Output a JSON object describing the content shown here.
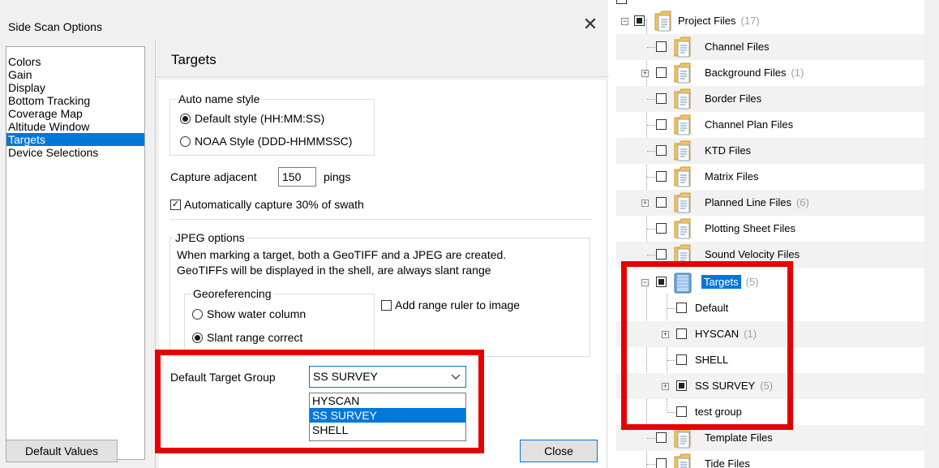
{
  "dialog": {
    "title": "Side Scan Options",
    "close_glyph": "✕",
    "nav_items": [
      "Colors",
      "Gain",
      "Display",
      "Bottom Tracking",
      "Coverage Map",
      "Altitude Window",
      "Targets",
      "Device Selections"
    ],
    "selected_nav": "Targets",
    "panel_heading": "Targets",
    "auto_name": {
      "label": "Auto name style",
      "options": [
        "Default style (HH:MM:SS)",
        "NOAA Style (DDD-HHMMSSC)"
      ],
      "selected": "Default style (HH:MM:SS)"
    },
    "capture": {
      "label": "Capture adjacent",
      "value": "150",
      "unit": "pings"
    },
    "auto_capture": {
      "label": "Automatically capture 30% of swath",
      "checked": true
    },
    "jpeg": {
      "label": "JPEG options",
      "desc_line1": "When marking a target, both a GeoTIFF and a JPEG are created.",
      "desc_line2": "GeoTIFFs will be displayed in the shell, are always slant range",
      "georef": {
        "label": "Georeferencing",
        "options": [
          "Show water column",
          "Slant range correct"
        ],
        "selected": "Slant range correct"
      },
      "range_ruler": {
        "label": "Add range ruler to image",
        "checked": false
      }
    },
    "target_group": {
      "label": "Default Target Group",
      "value": "SS SURVEY",
      "options": [
        "HYSCAN",
        "SS SURVEY",
        "SHELL"
      ],
      "highlighted": "SS SURVEY"
    },
    "buttons": {
      "default_values": "Default Values",
      "close": "Close"
    }
  },
  "tree": {
    "project_files": {
      "label": "Project Files",
      "count": "(17)"
    },
    "items": [
      {
        "label": "Channel Files",
        "count": ""
      },
      {
        "label": "Background Files",
        "count": "(1)"
      },
      {
        "label": "Border Files",
        "count": ""
      },
      {
        "label": "Channel Plan Files",
        "count": ""
      },
      {
        "label": "KTD Files",
        "count": ""
      },
      {
        "label": "Matrix Files",
        "count": ""
      },
      {
        "label": "Planned Line Files",
        "count": "(6)"
      },
      {
        "label": "Plotting Sheet Files",
        "count": ""
      },
      {
        "label": "Sound Velocity Files",
        "count": ""
      }
    ],
    "targets": {
      "label": "Targets",
      "count": "(5)",
      "children": [
        {
          "label": "Default",
          "count": ""
        },
        {
          "label": "HYSCAN",
          "count": "(1)"
        },
        {
          "label": "SHELL",
          "count": ""
        },
        {
          "label": "SS SURVEY",
          "count": "(5)"
        },
        {
          "label": "test group",
          "count": ""
        }
      ]
    },
    "after_items": [
      {
        "label": "Template Files",
        "count": ""
      },
      {
        "label": "Tide Files",
        "count": ""
      }
    ]
  },
  "colors": {
    "accent": "#0078d7",
    "highlight_box": "#e60000"
  }
}
